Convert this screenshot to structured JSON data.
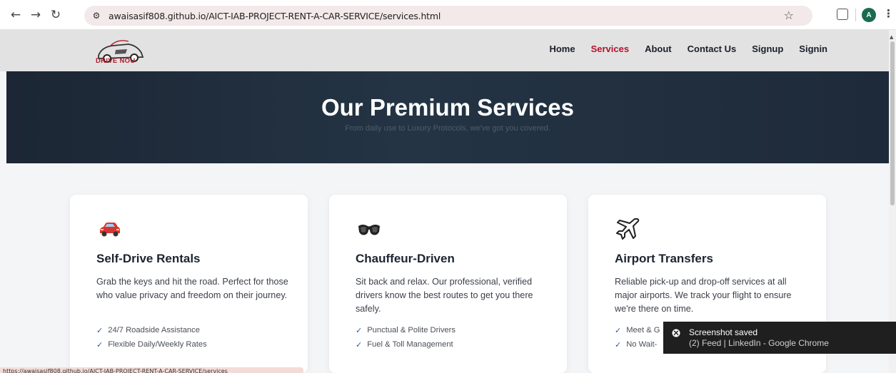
{
  "browser": {
    "url": "awaisasif808.github.io/AICT-IAB-PROJECT-RENT-A-CAR-SERVICE/services.html",
    "profile_initial": "A"
  },
  "site": {
    "logo_text": "DRIVE NOU",
    "nav": [
      {
        "label": "Home",
        "active": false
      },
      {
        "label": "Services",
        "active": true
      },
      {
        "label": "About",
        "active": false
      },
      {
        "label": "Contact Us",
        "active": false
      },
      {
        "label": "Signup",
        "active": false
      },
      {
        "label": "Signin",
        "active": false
      }
    ],
    "accent_color": "#b5132c"
  },
  "hero": {
    "title": "Our Premium Services",
    "subtitle": "From daily use to Luxury Protocols, we've got you covered."
  },
  "cards": [
    {
      "icon": "car-icon",
      "title": "Self-Drive Rentals",
      "description": "Grab the keys and hit the road. Perfect for those who value privacy and freedom on their journey.",
      "features": [
        "24/7 Roadside Assistance",
        "Flexible Daily/Weekly Rates"
      ]
    },
    {
      "icon": "sunglasses-icon",
      "title": "Chauffeur-Driven",
      "description": "Sit back and relax. Our professional, verified drivers know the best routes to get you there safely.",
      "features": [
        "Punctual & Polite Drivers",
        "Fuel & Toll Management"
      ]
    },
    {
      "icon": "airplane-icon",
      "title": "Airport Transfers",
      "description": "Reliable pick-up and drop-off services at all major airports. We track your flight to ensure we're there on time.",
      "features": [
        "Meet & G",
        "No Wait-"
      ]
    }
  ],
  "status_url": "https://awaisasif808.github.io/AICT-IAB-PROJECT-RENT-A-CAR-SERVICE/services",
  "toast": {
    "title": "Screenshot saved",
    "subtitle": "(2) Feed | LinkedIn - Google Chrome"
  }
}
